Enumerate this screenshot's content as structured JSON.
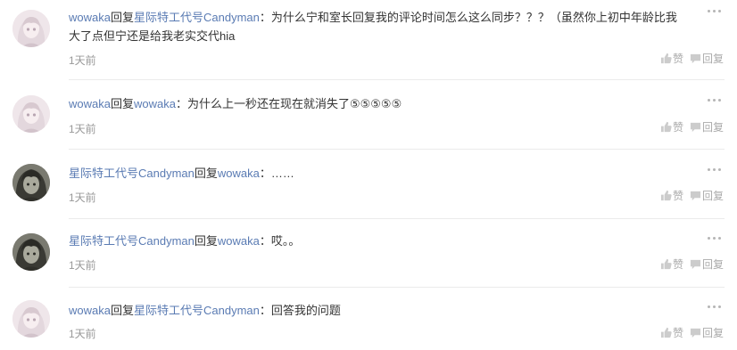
{
  "comments": [
    {
      "author": "wowaka",
      "verb": "回复",
      "target": "星际特工代号Candyman",
      "sep": "：",
      "text": "为什么宁和室长回复我的评论时间怎么这么同步？？？（虽然你上初中年龄比我大了点但宁还是给我老实交代hia",
      "time": "1天前",
      "like": "赞",
      "reply": "回复",
      "avatar": "anime-girl-avatar"
    },
    {
      "author": "wowaka",
      "verb": "回复",
      "target": "wowaka",
      "sep": "：",
      "text": "为什么上一秒还在现在就消失了⑤⑤⑤⑤⑤",
      "time": "1天前",
      "like": "赞",
      "reply": "回复",
      "avatar": "anime-girl-avatar"
    },
    {
      "author": "星际特工代号Candyman",
      "verb": "回复",
      "target": "wowaka",
      "sep": "：",
      "text": "……",
      "time": "1天前",
      "like": "赞",
      "reply": "回复",
      "avatar": "dark-character-avatar"
    },
    {
      "author": "星际特工代号Candyman",
      "verb": "回复",
      "target": "wowaka",
      "sep": "：",
      "text": "哎。。",
      "time": "1天前",
      "like": "赞",
      "reply": "回复",
      "avatar": "dark-character-avatar"
    },
    {
      "author": "wowaka",
      "verb": "回复",
      "target": "星际特工代号Candyman",
      "sep": "：",
      "text": "回答我的问题",
      "time": "1天前",
      "like": "赞",
      "reply": "回复",
      "avatar": "anime-girl-avatar"
    }
  ],
  "colors": {
    "link": "#5a7bb3",
    "text": "#333333",
    "muted": "#999999",
    "divider": "#ebebeb"
  }
}
